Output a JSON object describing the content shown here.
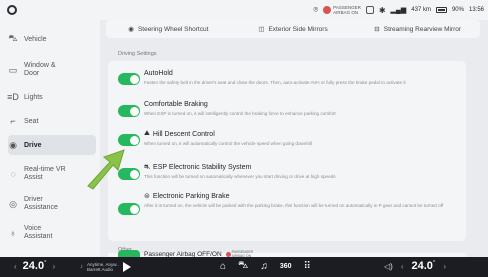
{
  "status": {
    "airbag_line1": "PASSENGER",
    "airbag_line2": "AIRBAG ON",
    "range": "437 km",
    "battery": "90%",
    "time": "13:56"
  },
  "sidebar": {
    "items": [
      {
        "label": "Vehicle",
        "icon": "car-icon"
      },
      {
        "label": "Window & Door",
        "icon": "window-icon"
      },
      {
        "label": "Lights",
        "icon": "lights-icon"
      },
      {
        "label": "Seat",
        "icon": "seat-icon"
      },
      {
        "label": "Drive",
        "icon": "steering-wheel-icon",
        "active": true
      },
      {
        "label": "Real-time VR Assist",
        "icon": "vr-assist-icon"
      },
      {
        "label": "Driver Assistance",
        "icon": "driver-assist-icon"
      },
      {
        "label": "Voice Assistant",
        "icon": "voice-icon"
      }
    ]
  },
  "shortcuts": {
    "steering": "Steering Wheel Shortcut",
    "mirrors": "Exterior Side Mirrors",
    "streaming": "Streaming Rearview Mirror"
  },
  "driving": {
    "section": "Driving Settings",
    "rows": [
      {
        "title": "AutoHold",
        "desc": "Fasten the safety belt in the driver's seat and close the doors. Then, auto-activate AVH or fully press the brake pedal to activate it",
        "on": true
      },
      {
        "title": "Comfortable Braking",
        "desc": "When ESP is turned on, it will intelligently control the braking force to enhance parking comfort",
        "on": true
      },
      {
        "title": "Hill Descent Control",
        "desc": "When turned on, it will automatically control the vehicle speed when going downhill",
        "on": true
      },
      {
        "title": "ESP Electronic Stability System",
        "desc": "This function will be turned on automatically whenever you start driving or drive at high speeds",
        "on": true
      },
      {
        "title": "Electronic Parking Brake",
        "desc": "After it is turned on, the vehicle will be parked with the parking brake, this function will be turned on automatically in P gear and cannot be turned off",
        "on": true
      }
    ]
  },
  "other": {
    "section": "Other",
    "row_title": "Passenger Airbag OFF/ON",
    "badge_line1": "PASSENGER",
    "badge_line2": "AIRBAG ON"
  },
  "bottom": {
    "temp_left": "24.0",
    "temp_right": "24.0",
    "media_line1": "Anytime, Anyw..",
    "media_line2": "Barrett Audio",
    "num360": "360"
  },
  "colors": {
    "toggle_on": "#27b85f",
    "arrow": "#8bc34a"
  }
}
